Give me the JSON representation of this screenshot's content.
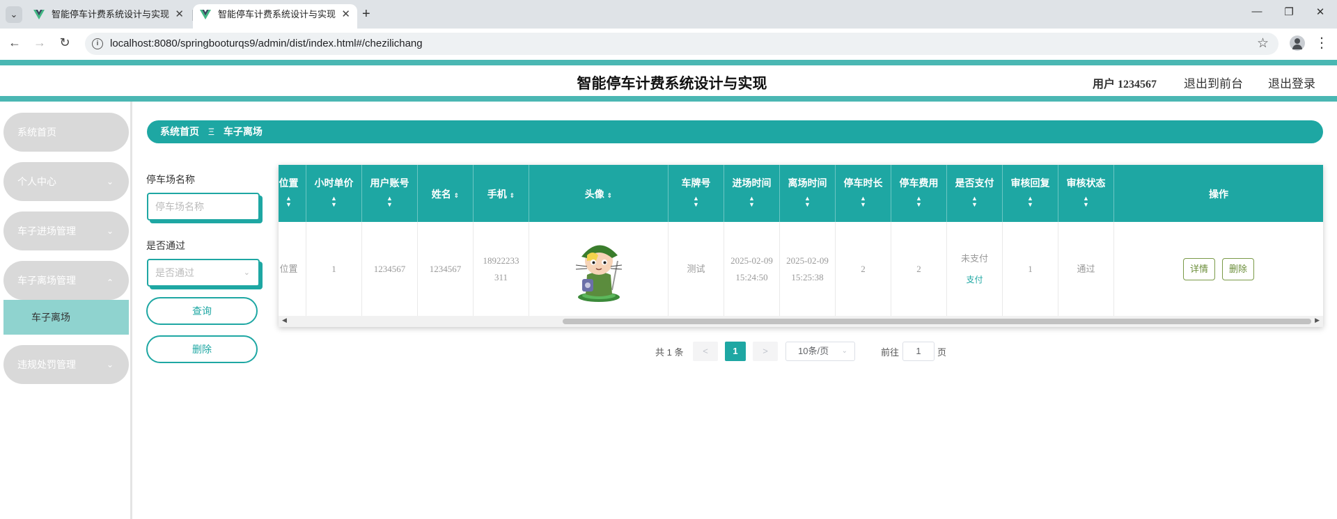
{
  "browser": {
    "tabs": [
      {
        "title": "智能停车计费系统设计与实现",
        "active": false
      },
      {
        "title": "智能停车计费系统设计与实现",
        "active": true
      }
    ],
    "url": "localhost:8080/springbooturqs9/admin/dist/index.html#/chezilichang",
    "icons": {
      "tab_menu": "chevron-down-icon",
      "favicon": "vue-logo-icon",
      "close": "close-icon",
      "new_tab": "plus-icon",
      "back": "arrow-left-icon",
      "forward": "arrow-right-icon",
      "reload": "reload-icon",
      "site_info": "info-icon",
      "bookmark": "star-icon",
      "profile": "profile-icon",
      "menu": "kebab-icon",
      "minimize": "minimize-icon",
      "restore": "restore-icon",
      "close_window": "close-icon"
    },
    "glyphs": {
      "tab_menu": "⌄",
      "close": "✕",
      "new_tab": "+",
      "back": "←",
      "forward": "→",
      "reload": "↻",
      "site_info": "i",
      "bookmark": "☆",
      "menu": "⋮",
      "minimize": "—",
      "restore": "❐",
      "close_window": "✕"
    }
  },
  "header": {
    "title": "智能停车计费系统设计与实现",
    "user": "用户 1234567",
    "links": [
      "退出到前台",
      "退出登录"
    ]
  },
  "sidebar": {
    "items": [
      {
        "label": "系统首页",
        "expandable": false
      },
      {
        "label": "个人中心",
        "expandable": true,
        "expanded": false
      },
      {
        "label": "车子进场管理",
        "expandable": true,
        "expanded": false
      },
      {
        "label": "车子离场管理",
        "expandable": true,
        "expanded": true
      },
      {
        "label": "违规处罚管理",
        "expandable": true,
        "expanded": false
      }
    ],
    "submenu": {
      "label": "车子离场"
    },
    "chevron_down": "⌄",
    "chevron_up": "⌃"
  },
  "breadcrumb": {
    "items": [
      "系统首页",
      "车子离场"
    ],
    "separator": "Ξ"
  },
  "search": {
    "parking_name_label": "停车场名称",
    "parking_name_placeholder": "停车场名称",
    "approved_label": "是否通过",
    "approved_placeholder": "是否通过",
    "query_button": "查询",
    "delete_button": "删除"
  },
  "table": {
    "sort_glyph": "▲\n▼",
    "columns": [
      "位置",
      "小时单价",
      "用户账号",
      "姓名",
      "手机",
      "头像",
      "车牌号",
      "进场时间",
      "离场时间",
      "停车时长",
      "停车费用",
      "是否支付",
      "审核回复",
      "审核状态",
      "操作"
    ],
    "rows": [
      {
        "location": "位置",
        "hourly_price": "1",
        "account": "1234567",
        "name": "1234567",
        "phone": "18922233311",
        "plate": "测试",
        "entry_time": "2025-02-09 15:24:50",
        "exit_time": "2025-02-09 15:25:38",
        "duration": "2",
        "fee": "2",
        "paid": "未支付",
        "pay_link": "支付",
        "reply": "1",
        "review_status": "通过",
        "detail_button": "详情",
        "delete_button": "删除"
      }
    ]
  },
  "pagination": {
    "total": "共 1 条",
    "prev": "<",
    "current": "1",
    "next": ">",
    "page_size": "10条/页",
    "goto_label": "前往",
    "goto_value": "1",
    "goto_suffix": "页"
  },
  "colors": {
    "accent": "#1ea7a3",
    "stripe": "#4ab7b3",
    "submenu_active": "#8fd3cf",
    "menu_bg": "#d9d9d9"
  }
}
